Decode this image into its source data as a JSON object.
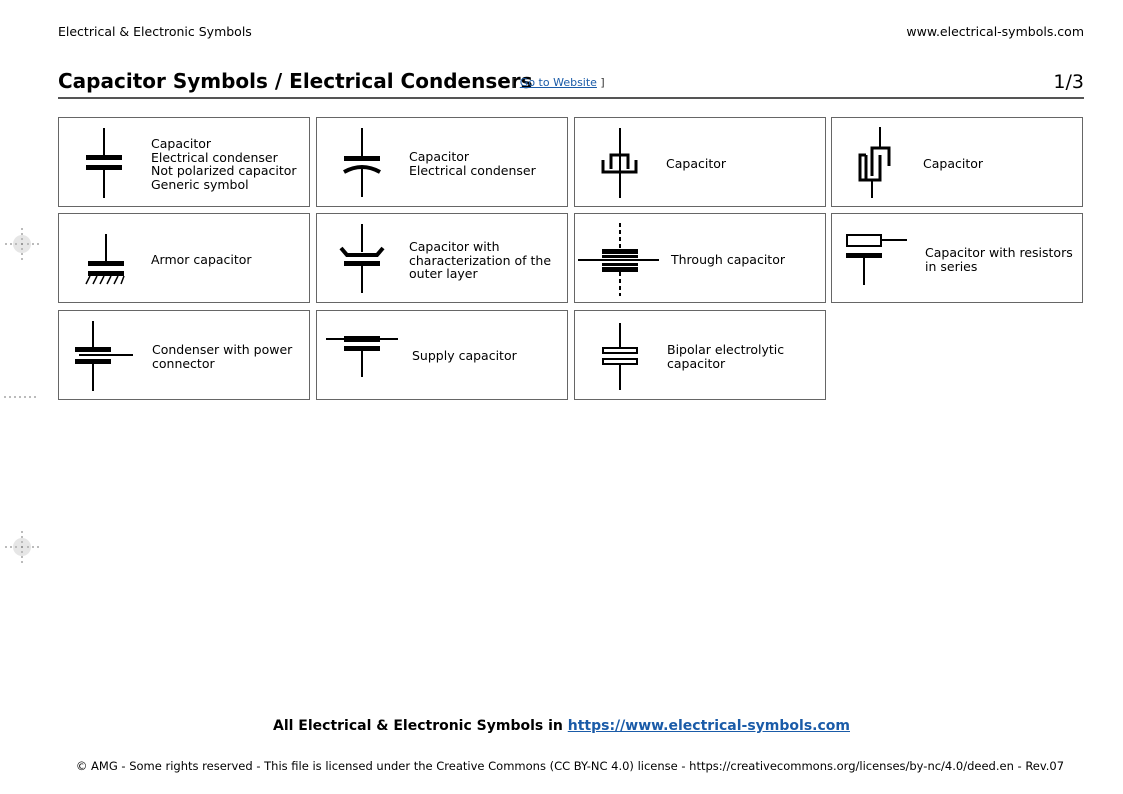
{
  "header": {
    "left_text": "Electrical & Electronic Symbols",
    "right_text": "www.electrical-symbols.com"
  },
  "title": {
    "text": "Capacitor Symbols / Electrical Condensers",
    "link_open": "[ ",
    "link_label": "Go to Website",
    "link_close": " ]",
    "page_number": "1/3"
  },
  "symbols": [
    {
      "name": "capacitor-generic",
      "icon": "capacitor-icon",
      "lines": [
        "Capacitor",
        "Electrical condenser",
        "Not polarized capacitor",
        "Generic symbol"
      ]
    },
    {
      "name": "capacitor-curved",
      "icon": "capacitor-curved-plate-icon",
      "lines": [
        "Capacitor",
        "Electrical condenser"
      ]
    },
    {
      "name": "capacitor-interlocked",
      "icon": "capacitor-interlocked-icon",
      "lines": [
        "Capacitor"
      ]
    },
    {
      "name": "capacitor-meander",
      "icon": "capacitor-meander-icon",
      "lines": [
        "Capacitor"
      ]
    },
    {
      "name": "armor-capacitor",
      "icon": "armor-capacitor-icon",
      "lines": [
        "Armor capacitor"
      ]
    },
    {
      "name": "capacitor-outer-layer",
      "icon": "capacitor-outer-layer-icon",
      "lines": [
        "Capacitor with",
        "characterization of the",
        "outer layer"
      ]
    },
    {
      "name": "through-capacitor",
      "icon": "through-capacitor-icon",
      "lines": [
        "Through capacitor"
      ]
    },
    {
      "name": "capacitor-resistors-series",
      "icon": "capacitor-resistor-icon",
      "lines": [
        "Capacitor with resistors",
        "in series"
      ]
    },
    {
      "name": "condenser-power-connector",
      "icon": "condenser-power-connector-icon",
      "lines": [
        "Condenser with power",
        "connector"
      ]
    },
    {
      "name": "supply-capacitor",
      "icon": "supply-capacitor-icon",
      "lines": [
        "Supply capacitor"
      ]
    },
    {
      "name": "bipolar-electrolytic-capacitor",
      "icon": "bipolar-electrolytic-capacitor-icon",
      "lines": [
        "Bipolar electrolytic",
        "capacitor"
      ]
    }
  ],
  "footer": {
    "main_prefix": "All Electrical & Electronic Symbols in ",
    "main_link": "https://www.electrical-symbols.com",
    "copyright": "© AMG - Some rights reserved - This file is licensed under the Creative Commons (CC BY-NC 4.0) license - https://creativecommons.org/licenses/by-nc/4.0/deed.en - Rev.07"
  }
}
